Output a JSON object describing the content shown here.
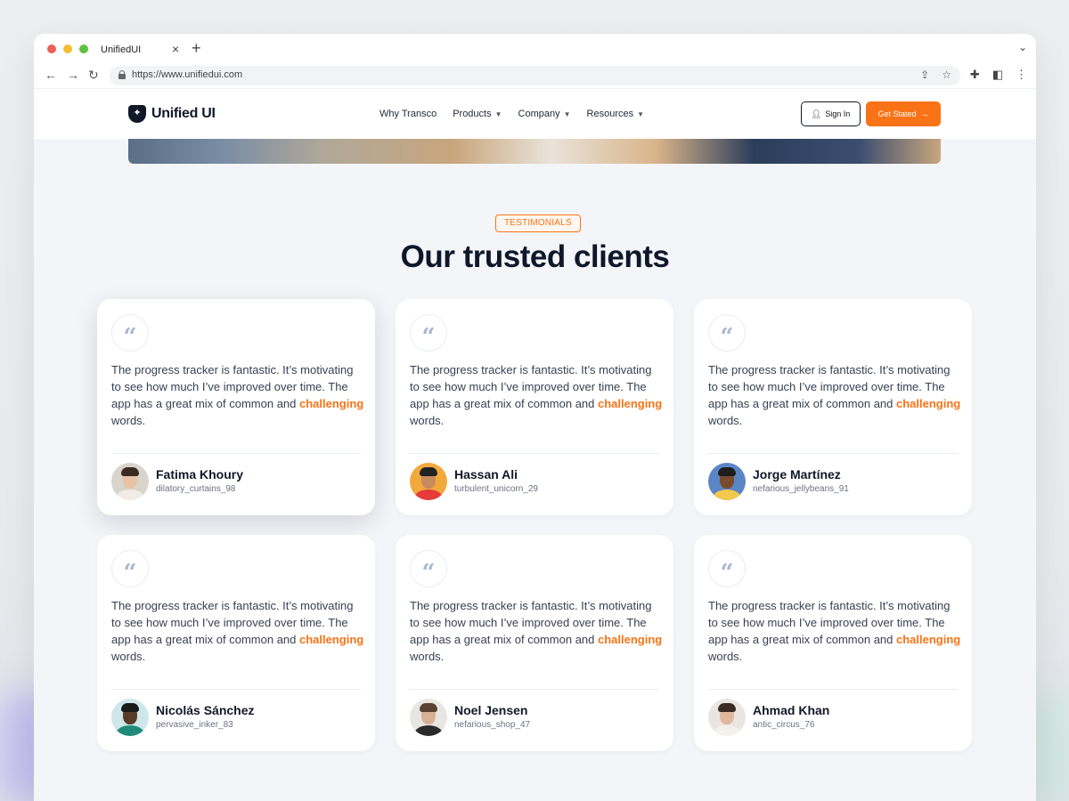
{
  "browser": {
    "tab_title": "UnifiedUI",
    "url": "https://www.unifiedui.com"
  },
  "nav": {
    "logo_text": "Unified UI",
    "menu": [
      {
        "label": "Why Transco",
        "has_caret": false
      },
      {
        "label": "Products",
        "has_caret": true
      },
      {
        "label": "Company",
        "has_caret": true
      },
      {
        "label": "Resources",
        "has_caret": true
      }
    ],
    "signin_label": "Sign In",
    "cta_label": "Get Stated"
  },
  "section": {
    "badge": "TESTIMONIALS",
    "title": "Our trusted clients"
  },
  "testimonials": [
    {
      "text_before": "The progress tracker is fantastic. It’s motivating to see how much I’ve improved over time. The app has a great mix of common and ",
      "highlight": "challenging",
      "text_after": " words.",
      "name": "Fatima Khoury",
      "handle": "dilatory_curtains_98"
    },
    {
      "text_before": "The progress tracker is fantastic. It’s motivating to see how much I’ve improved over time. The app has a great mix of common and ",
      "highlight": "challenging",
      "text_after": " words.",
      "name": "Hassan Ali",
      "handle": "turbulent_unicorn_29"
    },
    {
      "text_before": "The progress tracker is fantastic. It’s motivating to see how much I’ve improved over time. The app has a great mix of common and ",
      "highlight": "challenging",
      "text_after": " words.",
      "name": "Jorge Martínez",
      "handle": "nefarious_jellybeans_91"
    },
    {
      "text_before": "The progress tracker is fantastic. It’s motivating to see how much I’ve improved over time. The app has a great mix of common and ",
      "highlight": "challenging",
      "text_after": " words.",
      "name": "Nicolás Sánchez",
      "handle": "pervasive_inker_83"
    },
    {
      "text_before": "The progress tracker is fantastic. It’s motivating to see how much I’ve improved over time. The app has a great mix of common and ",
      "highlight": "challenging",
      "text_after": " words.",
      "name": "Noel Jensen",
      "handle": "nefarious_shop_47"
    },
    {
      "text_before": "The progress tracker is fantastic. It’s motivating to see how much I’ve improved over time. The app has a great mix of common and ",
      "highlight": "challenging",
      "text_after": " words.",
      "name": "Ahmad Khan",
      "handle": "antic_circus_76"
    }
  ],
  "avatars": [
    {
      "bg": "#d9d4cc",
      "skin": "#e9c3a6",
      "hair": "#3a2a22",
      "shirt": "#f1ece6"
    },
    {
      "bg": "#f2a93b",
      "skin": "#c98a5e",
      "hair": "#222222",
      "shirt": "#e63b3b"
    },
    {
      "bg": "#5b86c6",
      "skin": "#7a4a2e",
      "hair": "#1d1d1d",
      "shirt": "#f2c94c"
    },
    {
      "bg": "#cfe7ea",
      "skin": "#5a3b2a",
      "hair": "#1a1a1a",
      "shirt": "#1f8a7a"
    },
    {
      "bg": "#e8e6e3",
      "skin": "#d8b097",
      "hair": "#5a4030",
      "shirt": "#2b2b2b"
    },
    {
      "bg": "#e9e6e2",
      "skin": "#e0b99c",
      "hair": "#3a2a22",
      "shirt": "#f4f1ed"
    }
  ],
  "colors": {
    "accent": "#f97316",
    "dark": "#111827"
  },
  "icons": {
    "back": "arrow-left-icon",
    "forward": "arrow-right-icon",
    "reload": "reload-icon",
    "lock": "lock-icon",
    "share": "share-icon",
    "bookmark": "star-icon",
    "extensions": "puzzle-icon",
    "sidepanel": "sidepanel-icon",
    "more": "kebab-icon",
    "user": "user-icon",
    "arrow": "arrow-right-icon",
    "quote": "quote-icon"
  }
}
